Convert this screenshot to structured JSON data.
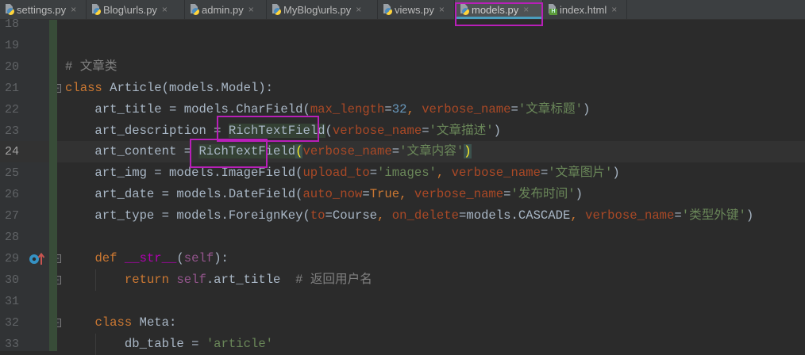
{
  "tabs": [
    {
      "label": "settings.py",
      "icon": "python-file-icon"
    },
    {
      "label": "Blog\\urls.py",
      "icon": "python-file-icon"
    },
    {
      "label": "admin.py",
      "icon": "python-file-icon"
    },
    {
      "label": "MyBlog\\urls.py",
      "icon": "python-file-icon"
    },
    {
      "label": "views.py",
      "icon": "python-file-icon"
    },
    {
      "label": "models.py",
      "icon": "python-file-icon",
      "active": true
    },
    {
      "label": "index.html",
      "icon": "html-file-icon"
    }
  ],
  "close_glyph": "×",
  "current_line": 24,
  "lines": [
    {
      "n": "18",
      "t": []
    },
    {
      "n": "19",
      "t": []
    },
    {
      "n": "20",
      "t": [
        [
          "# 文章类",
          "c"
        ]
      ]
    },
    {
      "n": "21",
      "t": [
        [
          "class ",
          "k"
        ],
        [
          "Article(models.Model):",
          ""
        ]
      ]
    },
    {
      "n": "22",
      "t": [
        [
          "    art_title = models.CharField(",
          ""
        ],
        [
          "max_length",
          "a"
        ],
        [
          "=",
          ""
        ],
        [
          "32",
          "n"
        ],
        [
          ", ",
          "k"
        ],
        [
          "verbose_name",
          "a"
        ],
        [
          "=",
          ""
        ],
        [
          "'文章标题'",
          "s"
        ],
        [
          ")",
          ""
        ]
      ]
    },
    {
      "n": "23",
      "t": [
        [
          "    art_description = ",
          ""
        ],
        [
          "RichTextField",
          "hl"
        ],
        [
          "(",
          ""
        ],
        [
          "verbose_name",
          "a"
        ],
        [
          "=",
          ""
        ],
        [
          "'文章描述'",
          "s"
        ],
        [
          ")",
          ""
        ]
      ]
    },
    {
      "n": "24",
      "t": [
        [
          "    art_content = ",
          ""
        ],
        [
          "RichTextField",
          "hl"
        ],
        [
          "(",
          "br"
        ],
        [
          "verbose_name",
          "a"
        ],
        [
          "=",
          ""
        ],
        [
          "'文章内容'",
          "s"
        ],
        [
          ")",
          "br"
        ]
      ]
    },
    {
      "n": "25",
      "t": [
        [
          "    art_img = models.ImageField(",
          ""
        ],
        [
          "upload_to",
          "a"
        ],
        [
          "=",
          ""
        ],
        [
          "'images'",
          "s"
        ],
        [
          ", ",
          "k"
        ],
        [
          "verbose_name",
          "a"
        ],
        [
          "=",
          ""
        ],
        [
          "'文章图片'",
          "s"
        ],
        [
          ")",
          ""
        ]
      ]
    },
    {
      "n": "26",
      "t": [
        [
          "    art_date = models.DateField(",
          ""
        ],
        [
          "auto_now",
          "a"
        ],
        [
          "=",
          ""
        ],
        [
          "True",
          "k"
        ],
        [
          ", ",
          "k"
        ],
        [
          "verbose_name",
          "a"
        ],
        [
          "=",
          ""
        ],
        [
          "'发布时间'",
          "s"
        ],
        [
          ")",
          ""
        ]
      ]
    },
    {
      "n": "27",
      "t": [
        [
          "    art_type = models.ForeignKey(",
          ""
        ],
        [
          "to",
          "a"
        ],
        [
          "=Course",
          ""
        ],
        [
          ", ",
          "k"
        ],
        [
          "on_delete",
          "a"
        ],
        [
          "=models.CASCADE",
          ""
        ],
        [
          ", ",
          "k"
        ],
        [
          "verbose_name",
          "a"
        ],
        [
          "=",
          ""
        ],
        [
          "'类型外键'",
          "s"
        ],
        [
          ")",
          ""
        ]
      ]
    },
    {
      "n": "28",
      "t": []
    },
    {
      "n": "29",
      "t": [
        [
          "    ",
          ""
        ],
        [
          "def ",
          "k"
        ],
        [
          "__str__",
          "d"
        ],
        [
          "(",
          ""
        ],
        [
          "self",
          "self"
        ],
        [
          "):",
          ""
        ]
      ]
    },
    {
      "n": "30",
      "t": [
        [
          "        ",
          ""
        ],
        [
          "return ",
          "k"
        ],
        [
          "self",
          "self"
        ],
        [
          ".art_title  ",
          ""
        ],
        [
          "# 返回用户名",
          "c"
        ]
      ]
    },
    {
      "n": "31",
      "t": []
    },
    {
      "n": "32",
      "t": [
        [
          "    ",
          ""
        ],
        [
          "class ",
          "k"
        ],
        [
          "Meta:",
          ""
        ]
      ]
    },
    {
      "n": "33",
      "t": [
        [
          "        db_table = ",
          ""
        ],
        [
          "'article'",
          "s"
        ]
      ]
    }
  ],
  "colors": {
    "keyword": "#cc7832",
    "string": "#6a8759",
    "kwarg": "#aa4926",
    "number": "#6897bb",
    "comment": "#808080",
    "annotation_box": "#b81fb8"
  }
}
